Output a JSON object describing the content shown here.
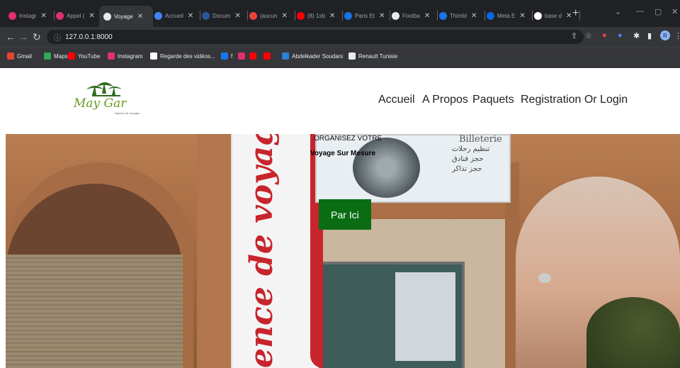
{
  "browser": {
    "tabs": [
      {
        "label": "Instagr",
        "color": "#e1306c"
      },
      {
        "label": "Appel (",
        "color": "#e1306c"
      },
      {
        "label": "Voyage",
        "color": "#e8eaed",
        "active": true
      },
      {
        "label": "Accueil",
        "color": "#4285f4"
      },
      {
        "label": "Docum",
        "color": "#2b579a"
      },
      {
        "label": "(aucun",
        "color": "#ea4335"
      },
      {
        "label": "(8) 1xb",
        "color": "#ff0000"
      },
      {
        "label": "Paris Et",
        "color": "#1a73e8"
      },
      {
        "label": "Footba",
        "color": "#e8eaed"
      },
      {
        "label": "Thimbl",
        "color": "#1a73e8"
      },
      {
        "label": "Meta E",
        "color": "#0668e1"
      },
      {
        "label": "base d",
        "color": "#ffffff"
      }
    ],
    "url": "127.0.0.1:8000",
    "bookmarks": [
      {
        "label": "Gmail",
        "color": "#ea4335"
      },
      {
        "label": "Maps",
        "color": "#34a853"
      },
      {
        "label": "YouTube",
        "color": "#ff0000"
      },
      {
        "label": "Instagram",
        "color": "#e1306c"
      },
      {
        "label": "Regarde des vidéos...",
        "color": "#ffffff"
      },
      {
        "label": "f",
        "color": "#1877f2"
      },
      {
        "label": "",
        "color": "#e1306c"
      },
      {
        "label": "",
        "color": "#ff0000"
      },
      {
        "label": "",
        "color": "#ff0000"
      },
      {
        "label": "Abdelkader Soudani",
        "color": "#2b7fd8"
      },
      {
        "label": "Renault Tunisie",
        "color": "#e8eaed"
      }
    ]
  },
  "site": {
    "logo_text": "May Gar",
    "logo_sub": "Agence de voyages",
    "nav": [
      "Accueil",
      "A Propos",
      "Paquets",
      "Registration Or Login"
    ]
  },
  "hero": {
    "line1": "ORGANISEZ VOTRE",
    "line2": "Voyage Sur Mesure",
    "cta": "Par Ici",
    "banner_text": "ence de voyages",
    "sign_title": "Billeterie",
    "sign_lines": [
      "تنظيم رحلات",
      "حجز فنادق",
      "حجز تذاكر"
    ]
  }
}
